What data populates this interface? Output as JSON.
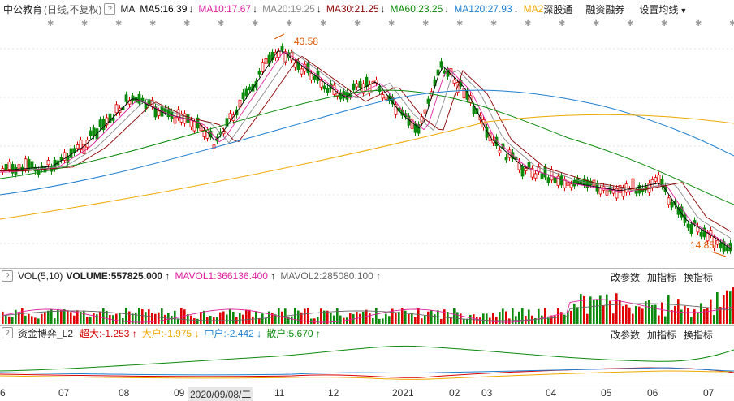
{
  "header": {
    "name": "中公教育",
    "mode": "(日线,不复权)",
    "ma_label": "MA",
    "ma5": "MA5:16.39",
    "ma10": "MA10:17.67",
    "ma20": "MA20:19.25",
    "ma30": "MA30:21.25",
    "ma60": "MA60:23.25",
    "ma120": "MA120:27.93",
    "ma2": "MA2",
    "shenguton": "深股通",
    "rzrq": "融资融券",
    "settings": "设置均线"
  },
  "price_labels": {
    "high": "43.58",
    "low": "14.85"
  },
  "vol_panel": {
    "title": "VOL(5,10)",
    "volume": "VOLUME:557825.000",
    "mavol1": "MAVOL1:366136.400",
    "mavol2": "MAVOL2:285080.100",
    "btn_change": "改参数",
    "btn_add": "加指标",
    "btn_switch": "换指标"
  },
  "fund_panel": {
    "title": "资金博弈_L2",
    "super": "超大:-1.253",
    "big": "大户:-1.975",
    "mid": "中户:-2.442",
    "retail": "散户:5.670",
    "btn_change": "改参数",
    "btn_add": "加指标",
    "btn_switch": "换指标"
  },
  "x_axis": [
    "6",
    "07",
    "08",
    "09",
    "2020/09/08/二",
    "11",
    "12",
    "2021",
    "02",
    "03",
    "04",
    "05",
    "06",
    "07"
  ],
  "colors": {
    "ma5": "#000000",
    "ma10": "#e0219e",
    "ma20": "#888888",
    "ma30": "#8b0000",
    "ma60": "#0a8a0a",
    "ma120": "#1e7fd0",
    "ma250": "#f0a800",
    "up": "#e00000",
    "down": "#0a8a0a"
  }
}
